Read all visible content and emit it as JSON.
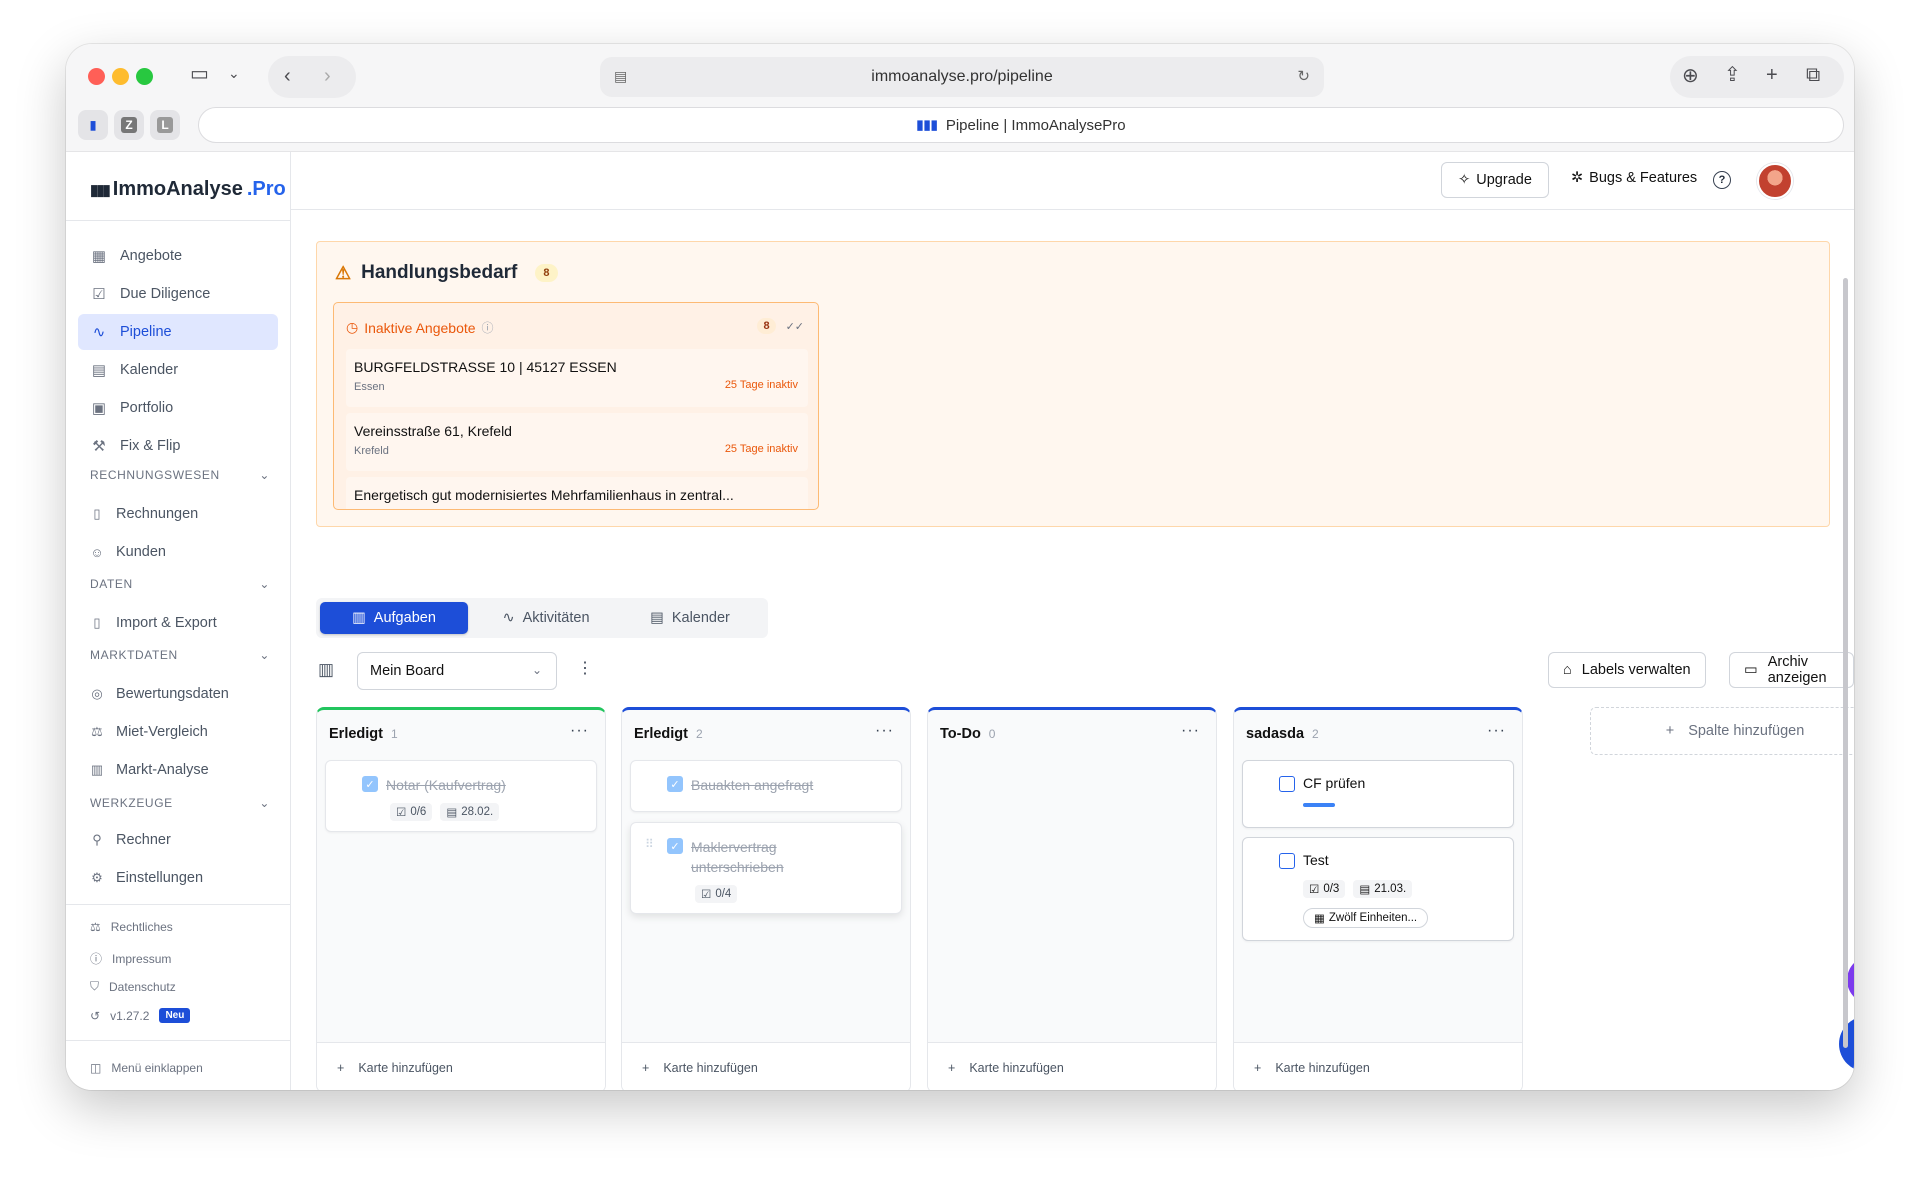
{
  "browser": {
    "url": "immoanalyse.pro/pipeline",
    "tab_title": "Pipeline | ImmoAnalysePro",
    "favicons": [
      "Z",
      "L"
    ]
  },
  "sidebar": {
    "logo_main": "ImmoAnalyse",
    "logo_suffix": ".Pro",
    "nav": [
      {
        "label": "Angebote",
        "icon": "building-icon"
      },
      {
        "label": "Due Diligence",
        "icon": "clipboard-icon"
      },
      {
        "label": "Pipeline",
        "icon": "activity-icon",
        "active": true
      },
      {
        "label": "Kalender",
        "icon": "calendar-icon"
      },
      {
        "label": "Portfolio",
        "icon": "briefcase-icon"
      },
      {
        "label": "Fix & Flip",
        "icon": "hammer-icon"
      }
    ],
    "sections": [
      {
        "title": "RECHNUNGSWESEN",
        "items": [
          "Rechnungen",
          "Kunden"
        ]
      },
      {
        "title": "DATEN",
        "items": [
          "Import & Export"
        ]
      },
      {
        "title": "MARKTDATEN",
        "items": [
          "Bewertungsdaten",
          "Miet-Vergleich",
          "Markt-Analyse"
        ]
      },
      {
        "title": "WERKZEUGE",
        "items": [
          "Rechner",
          "Einstellungen"
        ]
      }
    ],
    "footer": {
      "legal": "Rechtliches",
      "imprint": "Impressum",
      "privacy": "Datenschutz",
      "version": "v1.27.2",
      "version_badge": "Neu",
      "collapse": "Menü einklappen"
    }
  },
  "topbar": {
    "upgrade": "Upgrade",
    "bugs": "Bugs & Features",
    "help": "?"
  },
  "alert": {
    "title": "Handlungsbedarf",
    "count": "8",
    "panel_title": "Inaktive Angebote",
    "panel_count": "8",
    "items": [
      {
        "title": "BURGFELDSTRASSE 10 | 45127 ESSEN",
        "city": "Essen",
        "status": "25 Tage inaktiv"
      },
      {
        "title": "Vereinsstraße 61, Krefeld",
        "city": "Krefeld",
        "status": "25 Tage inaktiv"
      },
      {
        "title": "Energetisch gut modernisiertes Mehrfamilienhaus in zentral...",
        "city": "",
        "status": ""
      }
    ]
  },
  "tabs": [
    "Aufgaben",
    "Aktivitäten",
    "Kalender"
  ],
  "board": {
    "selected": "Mein Board",
    "labels_btn": "Labels verwalten",
    "archive_btn": "Archiv anzeigen",
    "add_column": "Spalte hinzufügen",
    "add_card": "Karte hinzufügen",
    "columns": [
      {
        "title": "Erledigt",
        "count": "1",
        "color": "#22c55e",
        "cards": [
          {
            "title": "Notar (Kaufvertrag)",
            "done": true,
            "checklist": "0/6",
            "date": "28.02."
          }
        ]
      },
      {
        "title": "Erledigt",
        "count": "2",
        "color": "#1d4ed8",
        "cards": [
          {
            "title": "Bauakten angefragt",
            "done": true
          },
          {
            "title": "Maklervertrag unterschrieben",
            "done": true,
            "checklist": "0/4"
          }
        ]
      },
      {
        "title": "To-Do",
        "count": "0",
        "color": "#1d4ed8",
        "cards": []
      },
      {
        "title": "sadasda",
        "count": "2",
        "color": "#1d4ed8",
        "cards": [
          {
            "title": "CF prüfen",
            "done": false
          },
          {
            "title": "Test",
            "done": false,
            "checklist": "0/3",
            "date": "21.03.",
            "label": "Zwölf Einheiten..."
          }
        ]
      }
    ]
  }
}
